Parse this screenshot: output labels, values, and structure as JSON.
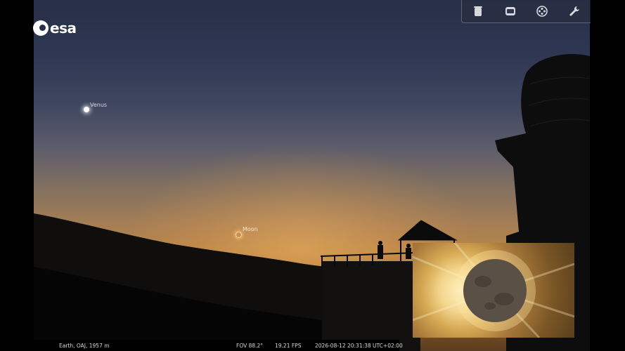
{
  "logo": {
    "text": "esa"
  },
  "toolbar": {
    "buttons": [
      {
        "name": "trash-icon"
      },
      {
        "name": "window-icon"
      },
      {
        "name": "film-reel-icon"
      },
      {
        "name": "wrench-icon"
      }
    ]
  },
  "sky": {
    "venus": {
      "label": "Venus"
    },
    "moon": {
      "label": "Moon"
    }
  },
  "inset": {
    "subject": "total solar eclipse corona view"
  },
  "status": {
    "location": "Earth, OAJ, 1957 m",
    "fov": "FOV 88.2°",
    "fps": "19.21 FPS",
    "datetime": "2026-08-12 20:31:38 UTC+02:00"
  },
  "colors": {
    "sky_top": "#273048",
    "horizon": "#b68447",
    "ground": "#0e0d0c"
  }
}
